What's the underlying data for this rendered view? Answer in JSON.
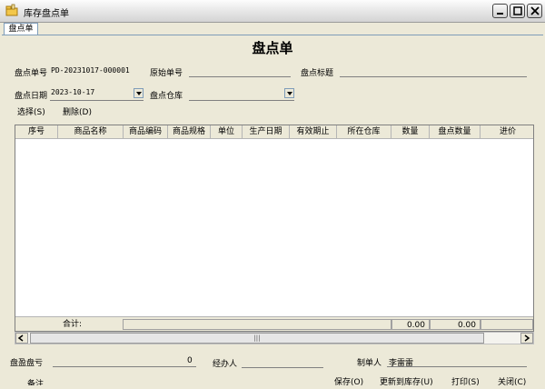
{
  "window": {
    "title": "库存盘点单",
    "icon": "folder-hand-icon"
  },
  "tab": {
    "label": "盘点单"
  },
  "form": {
    "title": "盘点单",
    "order_no_label": "盘点单号",
    "order_no_value": "PD-20231017-000001",
    "orig_no_label": "原始单号",
    "orig_no_value": "",
    "subject_label": "盘点标题",
    "subject_value": "",
    "date_label": "盘点日期",
    "date_value": "2023-10-17",
    "warehouse_label": "盘点仓库",
    "warehouse_value": "",
    "select_action": "选择(S)",
    "delete_action": "删除(D)"
  },
  "grid": {
    "columns": [
      "序号",
      "商品名称",
      "商品编码",
      "商品规格",
      "单位",
      "生产日期",
      "有效期止",
      "所在仓库",
      "数量",
      "盘点数量",
      "进价"
    ],
    "rows": [],
    "footer": {
      "total_label": "合计:",
      "qty_total": "0.00",
      "count_total": "0.00"
    }
  },
  "bottom": {
    "profit_label": "盘盈盘亏",
    "profit_value": "0",
    "handler_label": "经办人",
    "handler_value": "",
    "maker_label": "制单人",
    "maker_value": "李雷雷",
    "remark_label": "备注",
    "buttons": {
      "save": "保存(O)",
      "update_stock": "更新到库存(U)",
      "print": "打印(S)",
      "close": "关闭(C)"
    }
  },
  "colors": {
    "titlebar": "#e9e9e9",
    "face": "#ece9d8",
    "border": "#7f9db9"
  }
}
